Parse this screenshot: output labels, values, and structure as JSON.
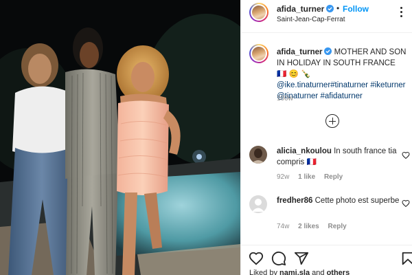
{
  "post": {
    "username": "afida_turner",
    "follow_label": "Follow",
    "separator": "•",
    "location": "Saint-Jean-Cap-Ferrat"
  },
  "caption": {
    "username": "afida_turner",
    "text": "MOTHER AND SON IN HOLIDAY IN SOUTH FRANCE",
    "emoji": "🇫🇷 😊 🍾",
    "tags": [
      "@ike.tinaturner",
      "#tinaturner",
      "#iketurner",
      "@tinaturner",
      "#afidaturner"
    ],
    "time": "100w"
  },
  "comments": [
    {
      "username": "alicia_nkoulou",
      "text": "In south france tia compris",
      "emoji": "🇫🇷",
      "time": "92w",
      "likes": "1 like",
      "reply": "Reply"
    },
    {
      "username": "fredher86",
      "text": "Cette photo est superbe",
      "emoji": "",
      "time": "74w",
      "likes": "2 likes",
      "reply": "Reply"
    }
  ],
  "actions": {
    "liked_by_prefix": "Liked by",
    "liked_by_user": "nami.sla",
    "liked_by_and": "and",
    "liked_by_others": "others"
  },
  "colors": {
    "accent": "#0095f6",
    "verified": "#3897f0",
    "text": "#262626",
    "muted": "#8e8e8e",
    "hashtag": "#00376b"
  },
  "icons": [
    "verified-icon",
    "more-options-icon",
    "load-more-comments-icon",
    "heart-icon",
    "comment-icon",
    "share-icon",
    "save-icon"
  ]
}
